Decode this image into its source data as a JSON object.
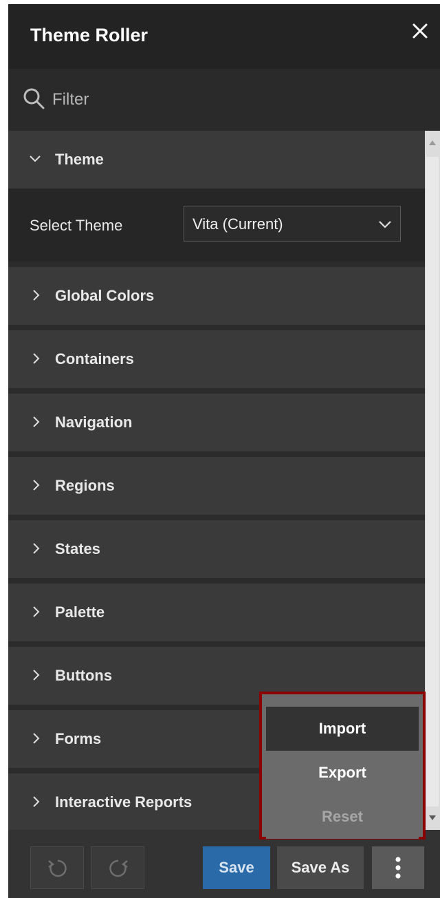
{
  "window": {
    "title": "Theme Roller",
    "close_icon": "close-icon"
  },
  "filter": {
    "placeholder": "Filter",
    "icon": "search-icon"
  },
  "theme_section": {
    "label": "Theme",
    "expanded": true,
    "select_label": "Select Theme",
    "select_value": "Vita (Current)"
  },
  "sections": [
    {
      "label": "Global Colors"
    },
    {
      "label": "Containers"
    },
    {
      "label": "Navigation"
    },
    {
      "label": "Regions"
    },
    {
      "label": "States"
    },
    {
      "label": "Palette"
    },
    {
      "label": "Buttons"
    },
    {
      "label": "Forms"
    },
    {
      "label": "Interactive Reports"
    }
  ],
  "footer": {
    "undo_icon": "undo-icon",
    "redo_icon": "redo-icon",
    "save_label": "Save",
    "save_as_label": "Save As",
    "more_icon": "vertical-ellipsis-icon"
  },
  "menu": {
    "items": [
      {
        "label": "Import",
        "state": "hover"
      },
      {
        "label": "Export",
        "state": "normal"
      },
      {
        "label": "Reset",
        "state": "disabled"
      }
    ],
    "highlight_color": "#8b0000"
  },
  "colors": {
    "panel_bg": "#2b2b2b",
    "header_bg": "#232323",
    "section_bg": "#3a3a3a",
    "primary_button": "#2a6aa8"
  }
}
